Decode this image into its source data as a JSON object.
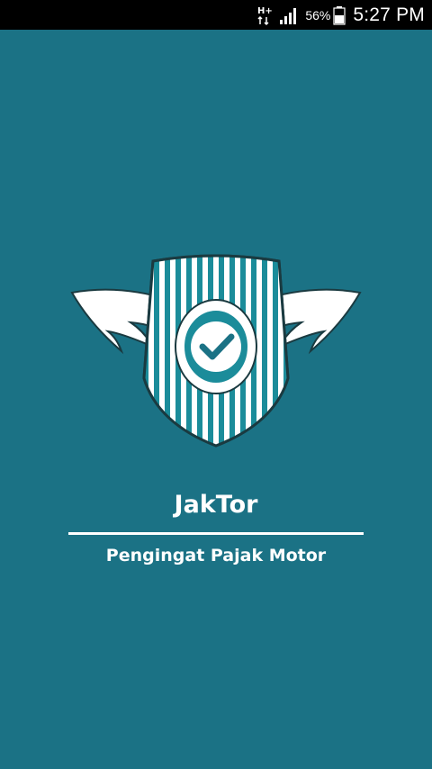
{
  "status_bar": {
    "network_label": "H+",
    "battery_percent": "56%",
    "time": "5:27 PM"
  },
  "app": {
    "title": "JakTor",
    "subtitle": "Pengingat Pajak Motor"
  },
  "colors": {
    "background": "#1b7285",
    "status_bar": "#000000",
    "text": "#ffffff",
    "shield_stripe": "#1b8c9a"
  },
  "icons": {
    "logo": "winged-shield-check-icon",
    "network": "h-plus-network-icon",
    "signal": "signal-strength-icon",
    "battery": "battery-icon"
  }
}
